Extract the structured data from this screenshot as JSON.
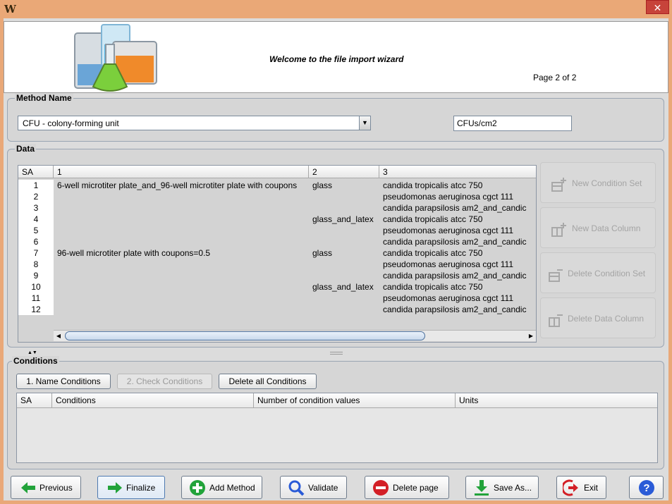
{
  "window": {
    "app_icon": "W",
    "close_icon": "close-icon"
  },
  "header": {
    "welcome": "Welcome to the file import wizard",
    "page_info": "Page 2 of 2",
    "logo_icon": "lab-glassware-icon"
  },
  "method": {
    "title": "Method Name",
    "selected": "CFU - colony-forming unit",
    "unit_value": "CFUs/cm2"
  },
  "data": {
    "title": "Data",
    "columns": [
      "SA",
      "1",
      "2",
      "3"
    ],
    "rows": [
      {
        "sa": "1",
        "c1": "6-well microtiter plate_and_96-well microtiter plate with coupons",
        "c2": "glass",
        "c3": "candida  tropicalis atcc 750"
      },
      {
        "sa": "2",
        "c1": "",
        "c2": "",
        "c3": "pseudomonas aeruginosa cgct 111"
      },
      {
        "sa": "3",
        "c1": "",
        "c2": "",
        "c3": "candida  parapsilosis am2_and_candic"
      },
      {
        "sa": "4",
        "c1": "",
        "c2": "glass_and_latex",
        "c3": "candida  tropicalis atcc 750"
      },
      {
        "sa": "5",
        "c1": "",
        "c2": "",
        "c3": "pseudomonas aeruginosa cgct 111"
      },
      {
        "sa": "6",
        "c1": "",
        "c2": "",
        "c3": "candida  parapsilosis am2_and_candic"
      },
      {
        "sa": "7",
        "c1": "96-well microtiter plate with coupons=0.5",
        "c2": "glass",
        "c3": "candida  tropicalis atcc 750"
      },
      {
        "sa": "8",
        "c1": "",
        "c2": "",
        "c3": "pseudomonas aeruginosa cgct 111"
      },
      {
        "sa": "9",
        "c1": "",
        "c2": "",
        "c3": "candida  parapsilosis am2_and_candic"
      },
      {
        "sa": "10",
        "c1": "",
        "c2": "glass_and_latex",
        "c3": "candida  tropicalis atcc 750"
      },
      {
        "sa": "11",
        "c1": "",
        "c2": "",
        "c3": "pseudomonas aeruginosa cgct 111"
      },
      {
        "sa": "12",
        "c1": "",
        "c2": "",
        "c3": "candida  parapsilosis am2_and_candic"
      }
    ],
    "side_buttons": {
      "new_condition_set": "New Condition Set",
      "new_data_column": "New Data Column",
      "delete_condition_set": "Delete Condition Set",
      "delete_data_column": "Delete Data Column"
    }
  },
  "conditions": {
    "title": "Conditions",
    "buttons": {
      "name_conditions": "1. Name Conditions",
      "check_conditions": "2. Check Conditions",
      "delete_all": "Delete all Conditions"
    },
    "columns": [
      "SA",
      "Conditions",
      "Number of condition values",
      "Units"
    ]
  },
  "footer": {
    "previous": "Previous",
    "finalize": "Finalize",
    "add_method": "Add Method",
    "validate": "Validate",
    "delete_page": "Delete page",
    "save_as": "Save As...",
    "exit": "Exit"
  },
  "colors": {
    "green": "#22a33a",
    "red": "#d31f26",
    "blue": "#2a5bd7"
  }
}
